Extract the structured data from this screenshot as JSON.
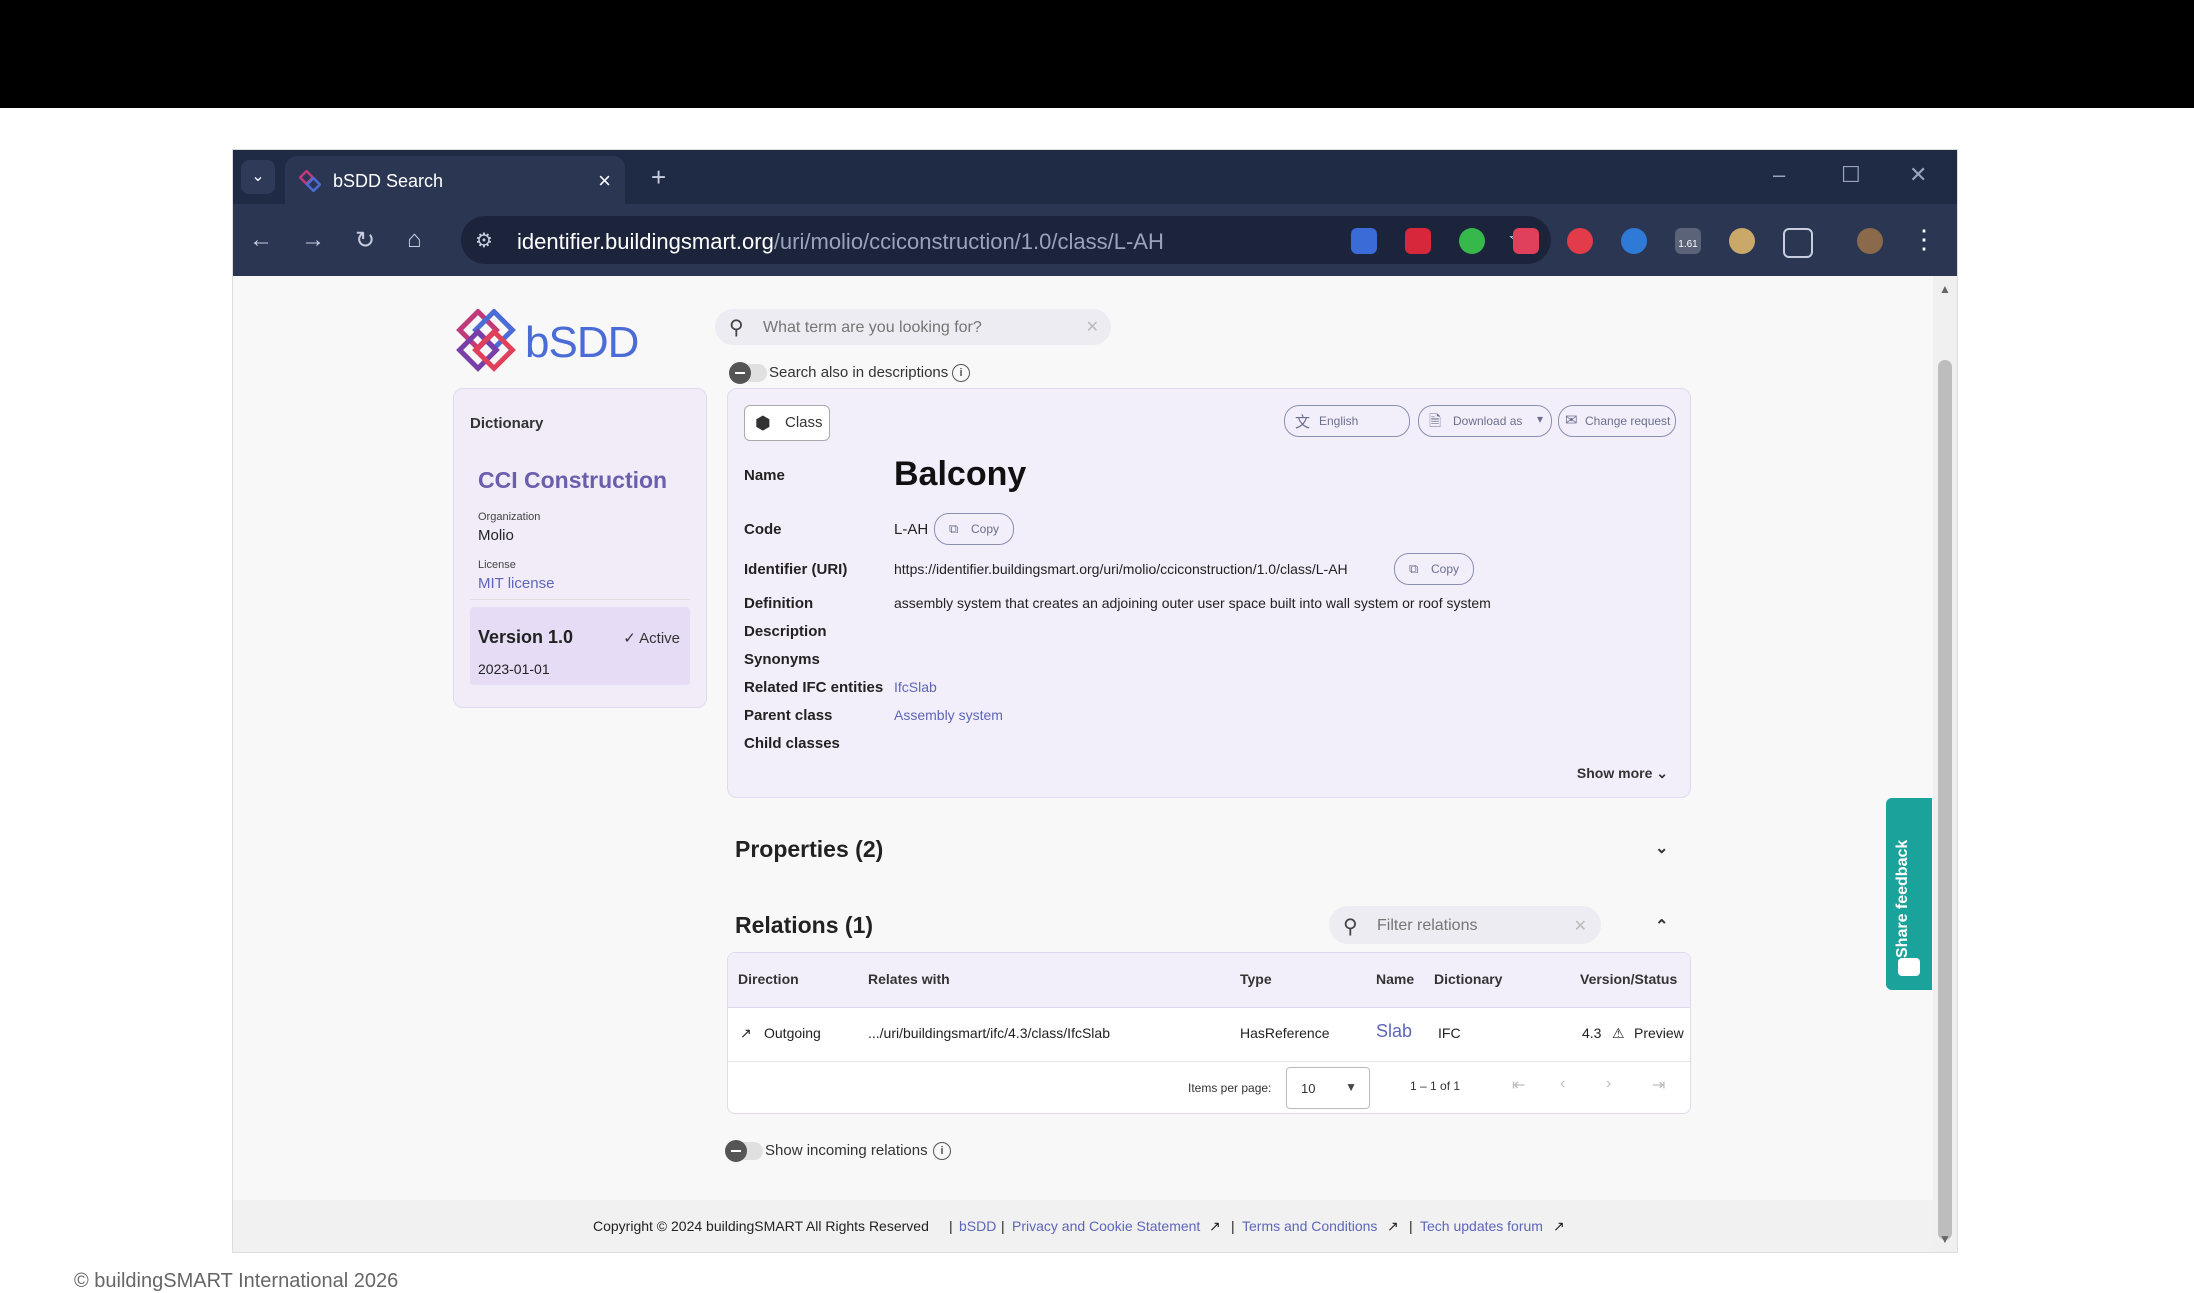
{
  "browser": {
    "tab_title": "bSDD Search",
    "url_host": "identifier.buildingsmart.org",
    "url_path": "/uri/molio/cciconstruction/1.0/class/L-AH",
    "ext_badge": "1.61"
  },
  "site": {
    "logo_text": "bSDD",
    "search_placeholder": "What term are you looking for?",
    "search_desc_label": "Search also in descriptions"
  },
  "dictionary": {
    "heading": "Dictionary",
    "name": "CCI Construction",
    "org_label": "Organization",
    "org_value": "Molio",
    "license_label": "License",
    "license_value": "MIT license",
    "version": "Version 1.0",
    "status": "Active",
    "date": "2023-01-01"
  },
  "class_card": {
    "chip": "Class",
    "lang_btn": "English",
    "download_btn": "Download as",
    "change_btn": "Change request",
    "copy_label": "Copy",
    "show_more": "Show more",
    "fields": {
      "name_label": "Name",
      "name_value": "Balcony",
      "code_label": "Code",
      "code_value": "L-AH",
      "uri_label": "Identifier (URI)",
      "uri_value": "https://identifier.buildingsmart.org/uri/molio/cciconstruction/1.0/class/L-AH",
      "def_label": "Definition",
      "def_value": "assembly system that creates an adjoining outer user space built into wall system or roof system",
      "desc_label": "Description",
      "syn_label": "Synonyms",
      "ifc_label": "Related IFC entities",
      "ifc_value": "IfcSlab",
      "parent_label": "Parent class",
      "parent_value": "Assembly system",
      "child_label": "Child classes"
    }
  },
  "properties": {
    "title": "Properties (2)"
  },
  "relations": {
    "title": "Relations (1)",
    "filter_placeholder": "Filter relations",
    "headers": [
      "Direction",
      "Relates with",
      "Type",
      "Name",
      "Dictionary",
      "Version/Status"
    ],
    "row": {
      "direction": "Outgoing",
      "relates_with": ".../uri/buildingsmart/ifc/4.3/class/IfcSlab",
      "type": "HasReference",
      "name": "Slab",
      "dictionary": "IFC",
      "version": "4.3",
      "status": "Preview"
    },
    "items_per_page_label": "Items per page:",
    "items_per_page": "10",
    "range": "1 – 1 of 1",
    "incoming_label": "Show incoming relations"
  },
  "footer": {
    "copyright": "Copyright © 2024   buildingSMART All Rights Reserved",
    "link_bsdd": "bSDD",
    "link_privacy": "Privacy and Cookie Statement",
    "link_terms": "Terms and Conditions",
    "link_forum": "Tech updates forum"
  },
  "feedback": {
    "label": "Share feedback"
  },
  "credit": "© buildingSMART International 2026",
  "colors": {
    "accent": "#6b5fad",
    "link": "#5d66b8",
    "card_bg": "#f3effa",
    "feedback": "#1aa39a",
    "browser_chrome": "#2b3653"
  }
}
